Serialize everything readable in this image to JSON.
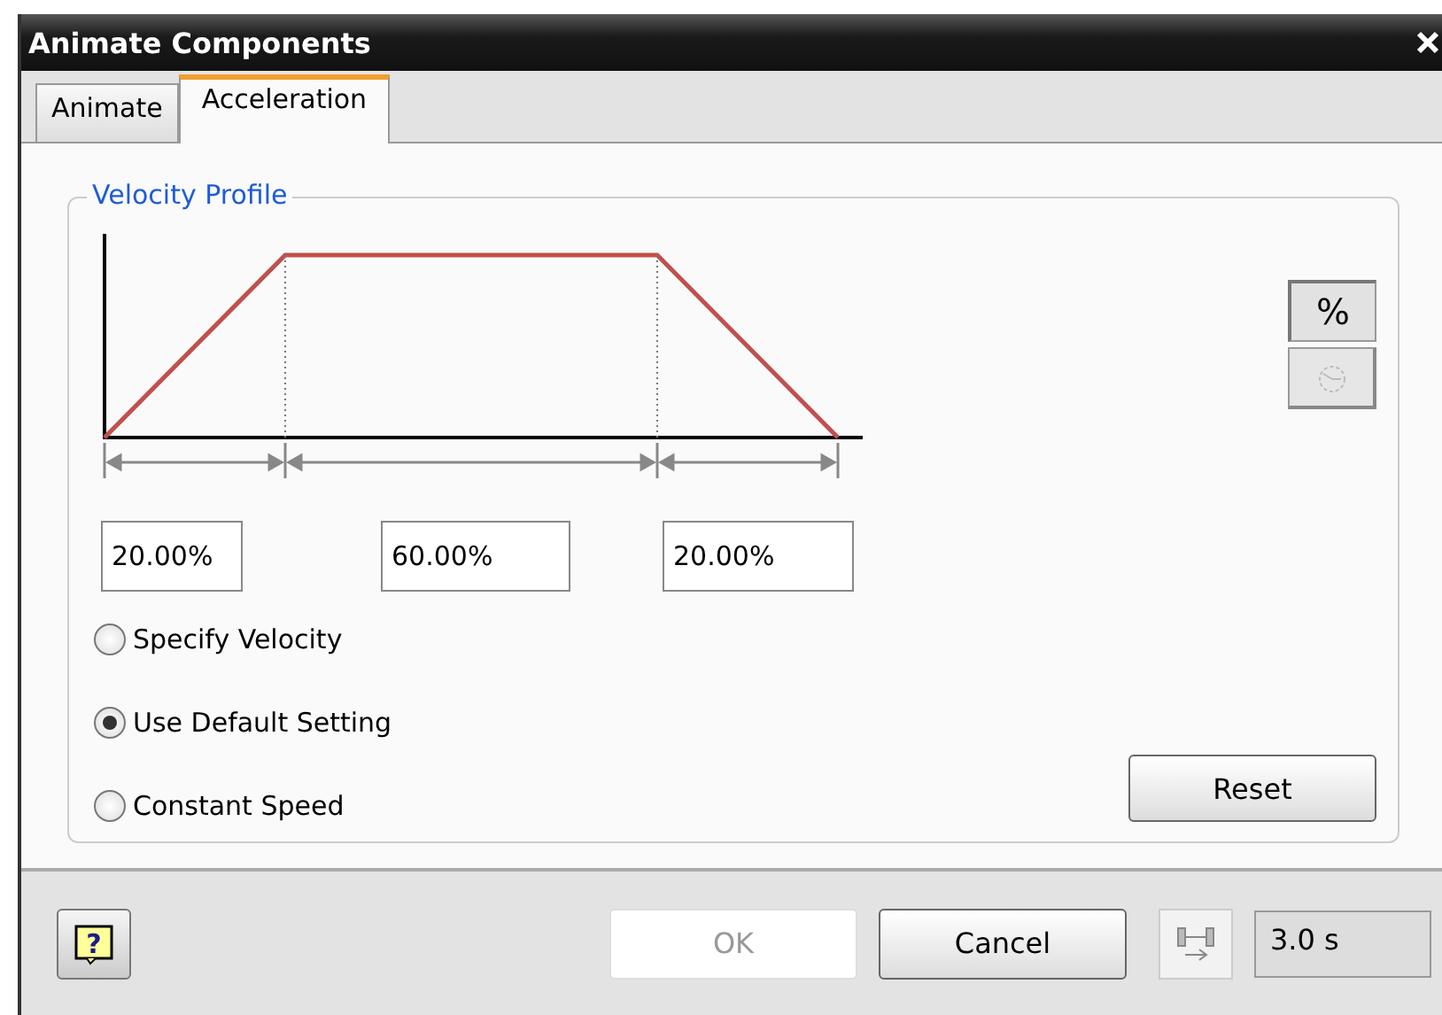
{
  "window": {
    "title": "Animate Components"
  },
  "tabs": [
    {
      "label": "Animate",
      "selected": false
    },
    {
      "label": "Acceleration",
      "selected": true
    }
  ],
  "velocity_profile": {
    "title": "Velocity Profile",
    "segments": [
      {
        "value": "20.00%"
      },
      {
        "value": "60.00%"
      },
      {
        "value": "20.00%"
      }
    ]
  },
  "unit_toggles": [
    {
      "kind": "percent",
      "label": "%",
      "selected": true,
      "disabled": false
    },
    {
      "kind": "time",
      "selected": false,
      "disabled": true
    }
  ],
  "options": [
    {
      "label": "Specify Velocity",
      "selected": false
    },
    {
      "label": "Use Default Setting",
      "selected": true
    },
    {
      "label": "Constant Speed",
      "selected": false
    }
  ],
  "reset_button": "Reset",
  "footer": {
    "help": "?",
    "ok": {
      "label": "OK",
      "disabled": true
    },
    "cancel": {
      "label": "Cancel",
      "disabled": false
    },
    "duration": "3.0 s"
  }
}
